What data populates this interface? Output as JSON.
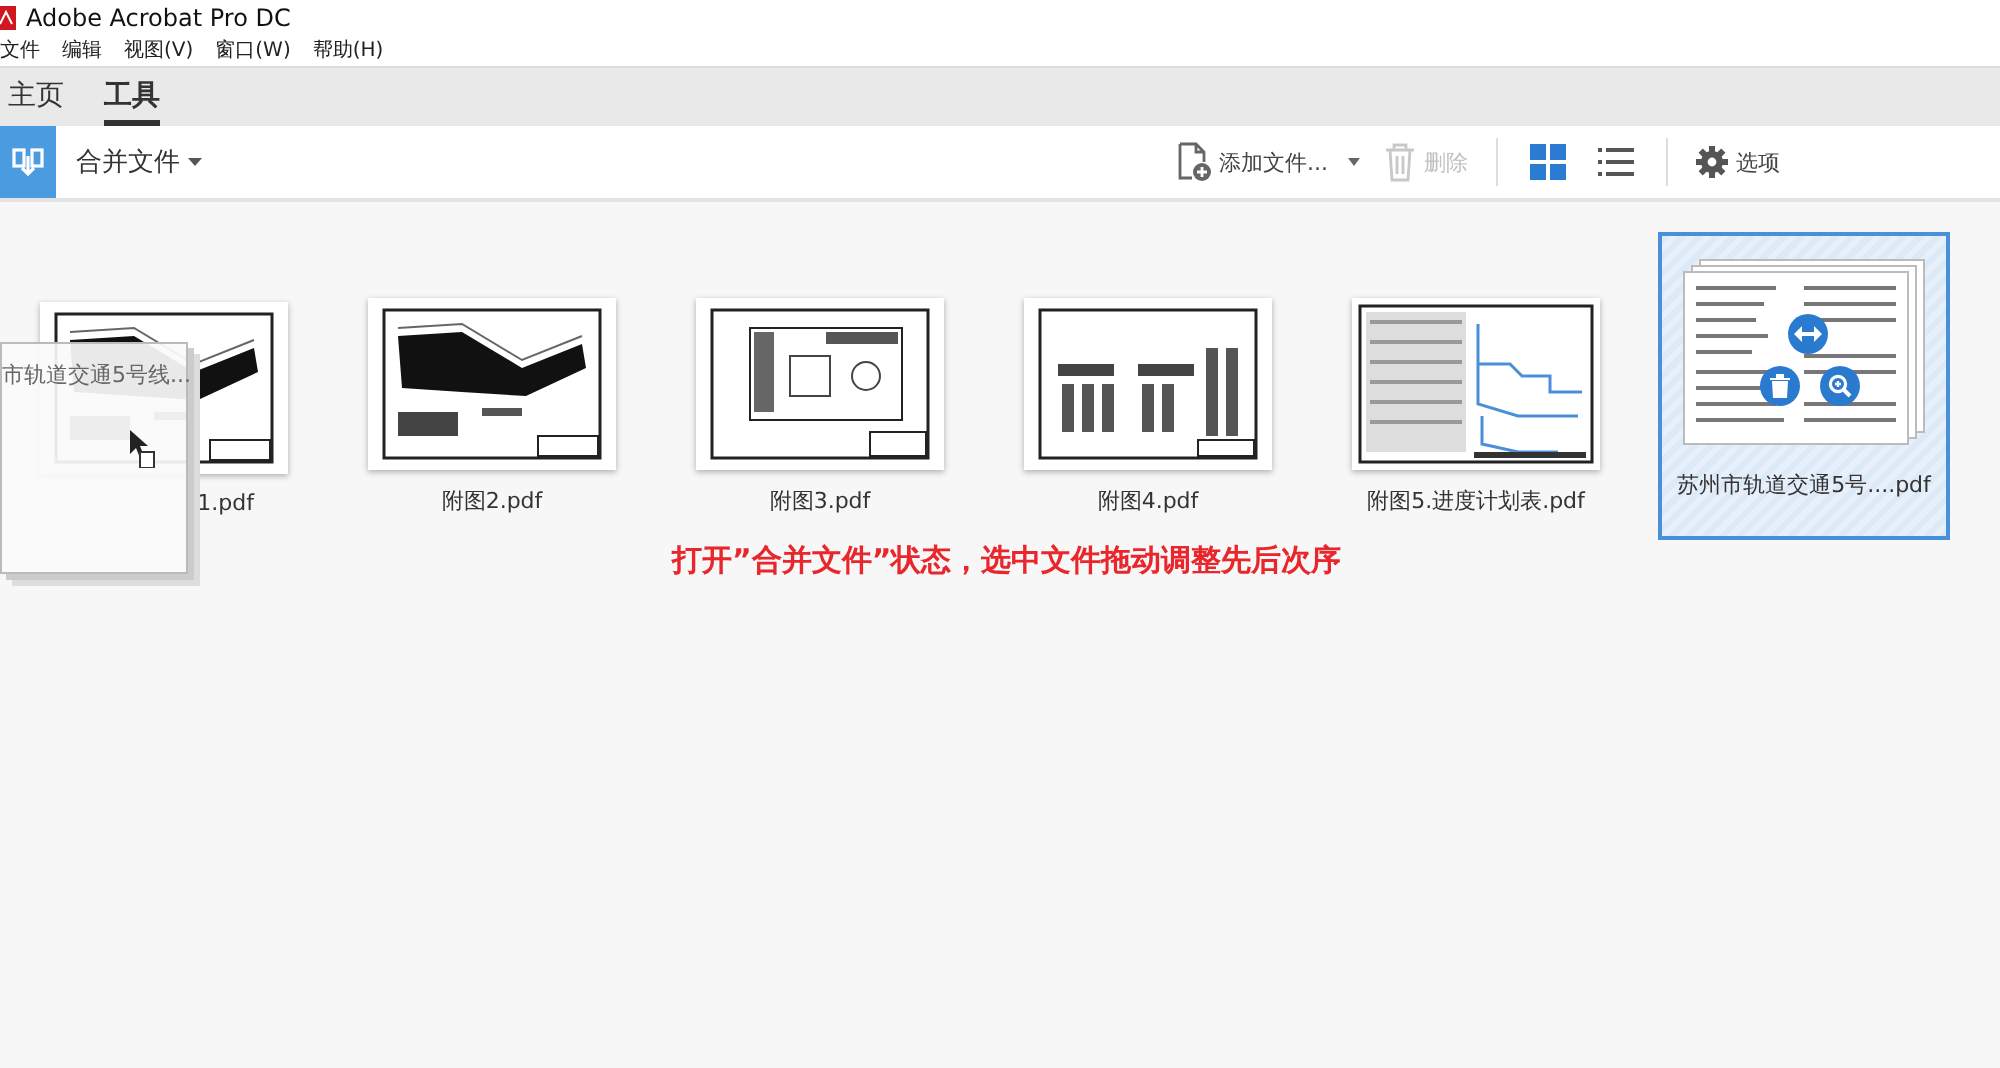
{
  "window": {
    "title": "Adobe Acrobat Pro DC"
  },
  "menu": [
    "文件",
    "编辑",
    "视图(V)",
    "窗口(W)",
    "帮助(H)"
  ],
  "tabs": [
    {
      "label": "主页",
      "selected": false
    },
    {
      "label": "工具",
      "selected": true
    }
  ],
  "toolbar": {
    "tool": "合并文件",
    "add_files": "添加文件...",
    "delete": {
      "label": "删除",
      "disabled": true
    },
    "views": [
      {
        "kind": "grid",
        "selected": true
      },
      {
        "kind": "list",
        "selected": false
      }
    ],
    "options": "选项"
  },
  "files": [
    {
      "name": "1.pdf",
      "kind": "site-plan",
      "selected": false
    },
    {
      "name": "附图2.pdf",
      "kind": "site-plan",
      "selected": false
    },
    {
      "name": "附图3.pdf",
      "kind": "floor-plan",
      "selected": false
    },
    {
      "name": "附图4.pdf",
      "kind": "rack-plan",
      "selected": false
    },
    {
      "name": "附图5.进度计划表.pdf",
      "kind": "gantt",
      "selected": false
    },
    {
      "name": "苏州市轨道交通5号....pdf",
      "kind": "document",
      "selected": true
    }
  ],
  "drag_ghost": {
    "label": "市轨道交通5号线..."
  },
  "annotation": "打开”合并文件”状态，选中文件拖动调整先后次序"
}
